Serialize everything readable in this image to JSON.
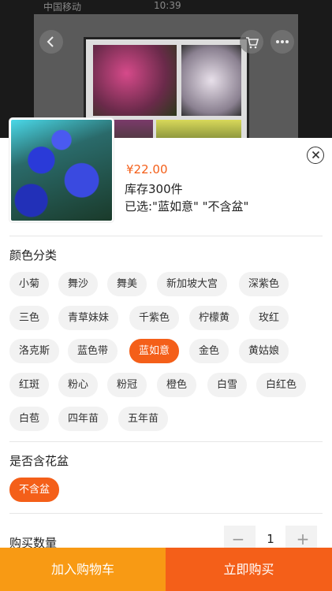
{
  "status_bar": {
    "left": "中国移动",
    "mid": "10:39"
  },
  "product": {
    "price": "¥22.00",
    "stock": "库存300件",
    "selected": "已选:\"蓝如意\" \"不含盆\""
  },
  "color_section": {
    "title": "颜色分类",
    "options": [
      [
        "小菊",
        "舞沙",
        "舞美",
        "新加坡大宫",
        "深紫色"
      ],
      [
        "三色",
        "青草妹妹",
        "千紫色",
        "柠檬黄",
        "玫红"
      ],
      [
        "洛克斯",
        "蓝色带",
        "蓝如意",
        "金色",
        "黄姑娘"
      ],
      [
        "红斑",
        "粉心",
        "粉冠",
        "橙色",
        "白雪",
        "白红色"
      ],
      [
        "白苞",
        "四年苗",
        "五年苗"
      ]
    ],
    "active": "蓝如意"
  },
  "pot_section": {
    "title": "是否含花盆",
    "options": [
      "不含盆"
    ],
    "active": "不含盆"
  },
  "quantity": {
    "label": "购买数量",
    "value": "1",
    "minus": "−",
    "plus": "+"
  },
  "actions": {
    "add_to_cart": "加入购物车",
    "buy_now": "立即购买"
  }
}
